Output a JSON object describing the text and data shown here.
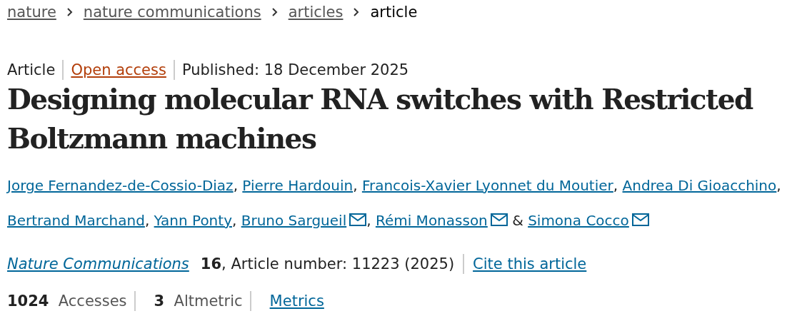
{
  "breadcrumbs": [
    {
      "label": "nature",
      "current": false
    },
    {
      "label": "nature communications",
      "current": false
    },
    {
      "label": "articles",
      "current": false
    },
    {
      "label": "article",
      "current": true
    }
  ],
  "meta": {
    "type": "Article",
    "access": "Open access",
    "published": "Published: 18 December 2025"
  },
  "title": "Designing molecular RNA switches with Restricted Boltzmann machines",
  "authors": [
    {
      "name": "Jorge Fernandez-de-Cossio-Diaz",
      "email": false,
      "separator": ","
    },
    {
      "name": "Pierre Hardouin",
      "email": false,
      "separator": ","
    },
    {
      "name": "Francois-Xavier Lyonnet du Moutier",
      "email": false,
      "separator": ","
    },
    {
      "name": "Andrea Di Gioacchino",
      "email": false,
      "separator": ","
    },
    {
      "name": "Bertrand Marchand",
      "email": false,
      "separator": ","
    },
    {
      "name": "Yann Ponty",
      "email": false,
      "separator": ","
    },
    {
      "name": "Bruno Sargueil",
      "email": true,
      "separator": ","
    },
    {
      "name": "Rémi Monasson",
      "email": true,
      "separator": "&"
    },
    {
      "name": "Simona Cocco",
      "email": true
    }
  ],
  "citation": {
    "journal": "Nature Communications",
    "volume": "16",
    "details": ", Article number: 11223 (2025)",
    "cite": "Cite this article"
  },
  "metrics": [
    {
      "kind": "count",
      "label": "**1024**  Accesses"
    },
    {
      "kind": "count",
      "label": "**3**  Altmetric"
    },
    {
      "kind": "link",
      "label": "Metrics"
    }
  ]
}
